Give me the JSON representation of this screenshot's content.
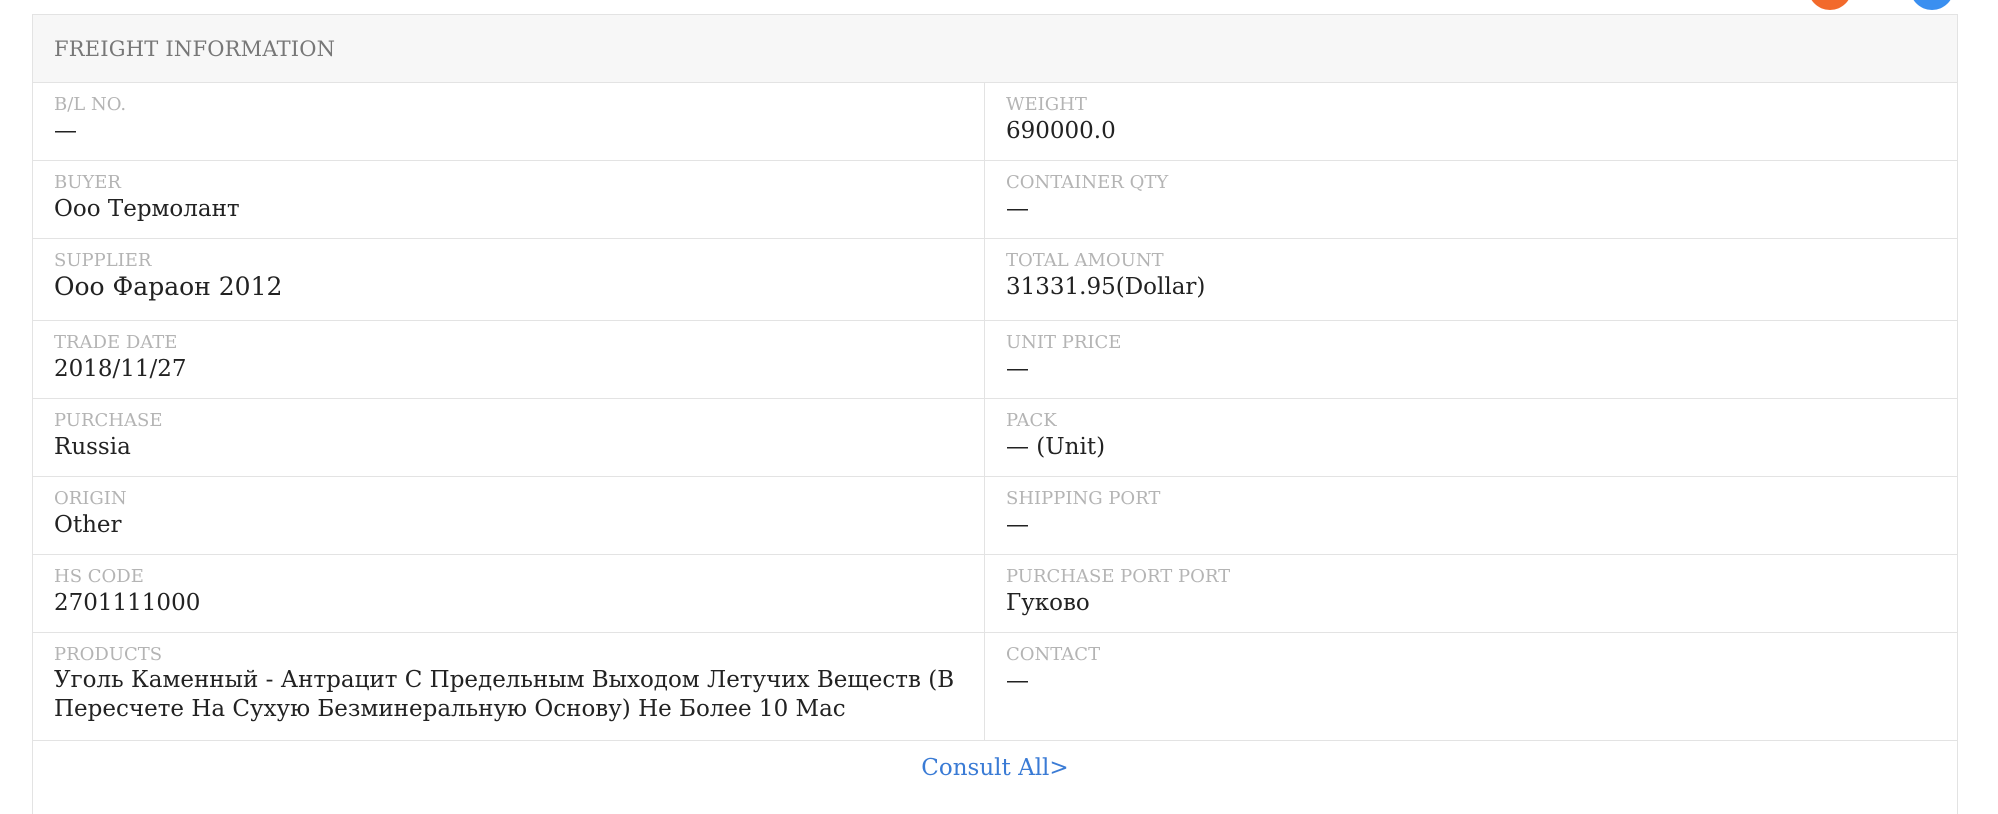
{
  "panel": {
    "title": "FREIGHT INFORMATION",
    "consult_link": "Consult All>"
  },
  "rows": [
    {
      "left": {
        "label": "B/L NO.",
        "value": "—"
      },
      "right": {
        "label": "WEIGHT",
        "value": "690000.0"
      }
    },
    {
      "left": {
        "label": "BUYER",
        "value": "Ооо Термолант"
      },
      "right": {
        "label": "CONTAINER QTY",
        "value": "—"
      }
    },
    {
      "left": {
        "label": "SUPPLIER",
        "value": "Ооо Фараон 2012"
      },
      "right": {
        "label": "TOTAL AMOUNT",
        "value": "31331.95(Dollar)"
      }
    },
    {
      "left": {
        "label": "TRADE DATE",
        "value": "2018/11/27"
      },
      "right": {
        "label": "UNIT PRICE",
        "value": "—"
      }
    },
    {
      "left": {
        "label": "PURCHASE",
        "value": "Russia"
      },
      "right": {
        "label": "PACK",
        "value": "— (Unit)"
      }
    },
    {
      "left": {
        "label": "ORIGIN",
        "value": "Other"
      },
      "right": {
        "label": "SHIPPING PORT",
        "value": "—"
      }
    },
    {
      "left": {
        "label": "HS CODE",
        "value": "2701111000"
      },
      "right": {
        "label": "PURCHASE PORT PORT",
        "value": "Гуково"
      }
    },
    {
      "left": {
        "label": "PRODUCTS",
        "value": "Уголь Каменный - Антрацит С Предельным Выходом Летучих Веществ (В Пересчете На Сухую Безминеральную Основу) Не Более 10 Мас"
      },
      "right": {
        "label": "CONTACT",
        "value": "—"
      }
    }
  ],
  "colors": {
    "accent_orange": "#f26a2c",
    "accent_blue": "#3a8ff0",
    "link": "#3a7bd5"
  }
}
